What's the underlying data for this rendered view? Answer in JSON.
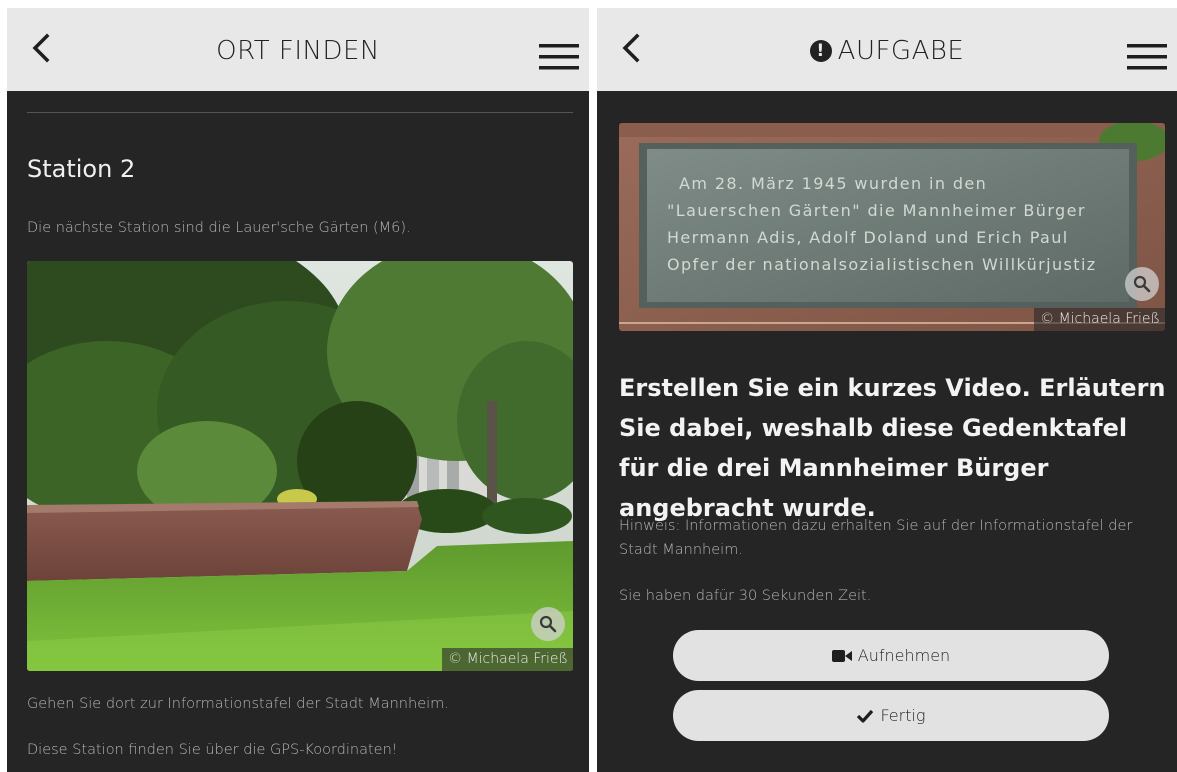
{
  "left_screen": {
    "header": {
      "title": "ORT FINDEN"
    },
    "station_title": "Station 2",
    "intro_text": "Die nächste Station sind die Lauer'sche Gärten (M6).",
    "photo_credit": "© Michaela Frieß",
    "instruction_text": "Gehen Sie dort zur Informationstafel der Stadt Mannheim.",
    "gps_text": "Diese Station finden Sie über die GPS-Koordinaten!"
  },
  "right_screen": {
    "header": {
      "title": "AUFGABE",
      "title_icon": "exclamation-circle-icon"
    },
    "plaque_lines": [
      "Am 28. März 1945 wurden in den",
      "\"Lauerschen Gärten\" die Mannheimer Bürger",
      "Hermann Adis, Adolf Doland und Erich Paul",
      "Opfer der nationalsozialistischen Willkürjustiz"
    ],
    "photo_credit": "© Michaela Frieß",
    "task_heading": "Erstellen Sie ein kurzes Video. Erläutern Sie dabei, weshalb diese Gedenktafel für die drei Mannheimer Bürger angebracht wurde.",
    "hint_text": "Hinweis: Informationen dazu erhalten Sie auf der Informationstafel der Stadt Mannheim.",
    "time_text": "Sie haben dafür 30 Sekunden Zeit.",
    "record_button": {
      "label": "Aufnehmen",
      "icon": "video-camera-icon"
    },
    "done_button": {
      "label": "Fertig",
      "icon": "checkmark-icon"
    }
  },
  "colors": {
    "header_bg": "#e8e8e8",
    "screen_bg": "#252525",
    "button_bg": "#e2e2e2",
    "body_text": "#b4b4b4"
  }
}
